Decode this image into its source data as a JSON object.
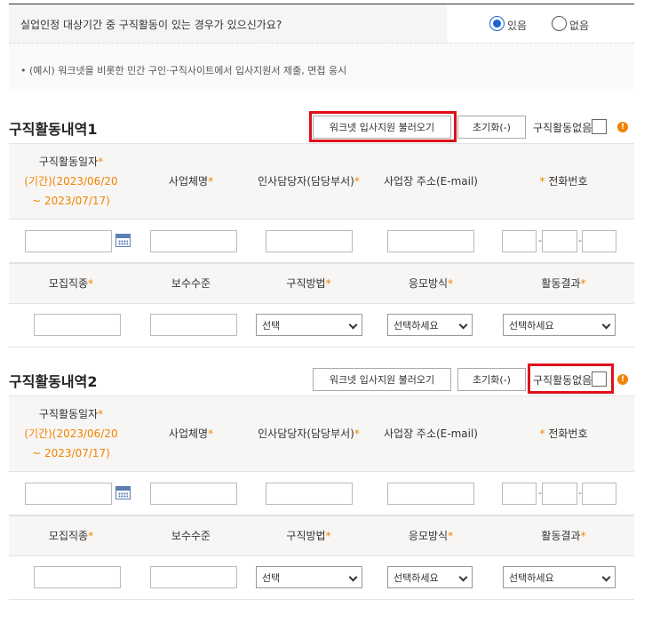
{
  "question": {
    "text": "실업인정 대상기간 중 구직활동이 있는 경우가 있으신가요?",
    "yes_label": "있음",
    "no_label": "없음",
    "selected": "있음"
  },
  "example": "• (예시) 워크넷을 비롯한 민간 구인·구직사이트에서 입사지원서 제출, 면접 응시",
  "sections": [
    {
      "title": "구직활동내역1",
      "import_button": "워크넷 입사지원 불러오기",
      "reset_button": "초기화(-)",
      "no_activity_label": "구직활동없음",
      "headers": {
        "date_label": "구직활동일자",
        "date_range_1": "(기간)(2023/06/20",
        "date_range_2": "~ 2023/07/17)",
        "company": "사업체명",
        "manager": "인사담당자(담당부서)",
        "email": "사업장 주소(E-mail)",
        "phone": "전화번호",
        "job_type": "모집직종",
        "salary": "보수수준",
        "method": "구직방법",
        "apply_type": "응모방식",
        "result": "활동결과"
      },
      "selects": {
        "method": "선택",
        "apply_type": "선택하세요",
        "result": "선택하세요"
      },
      "phone_dash": "-"
    },
    {
      "title": "구직활동내역2",
      "import_button": "워크넷 입사지원 불러오기",
      "reset_button": "초기화(-)",
      "no_activity_label": "구직활동없음",
      "headers": {
        "date_label": "구직활동일자",
        "date_range_1": "(기간)(2023/06/20",
        "date_range_2": "~ 2023/07/17)",
        "company": "사업체명",
        "manager": "인사담당자(담당부서)",
        "email": "사업장 주소(E-mail)",
        "phone": "전화번호",
        "job_type": "모집직종",
        "salary": "보수수준",
        "method": "구직방법",
        "apply_type": "응모방식",
        "result": "활동결과"
      },
      "selects": {
        "method": "선택",
        "apply_type": "선택하세요",
        "result": "선택하세요"
      },
      "phone_dash": "-"
    }
  ],
  "required_mark": "*",
  "warning_icon": "!",
  "colors": {
    "required": "#f08300",
    "highlight": "#e0101a",
    "radio": "#1b64d1"
  }
}
